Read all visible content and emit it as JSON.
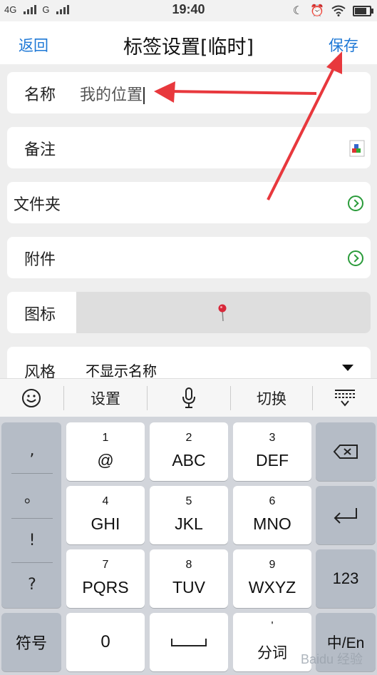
{
  "status_bar": {
    "signal1": "4G",
    "signal2": "G",
    "time": "19:40"
  },
  "header": {
    "back": "返回",
    "title": "标签设置[临时]",
    "save": "保存"
  },
  "form": {
    "name_label": "名称",
    "name_value": "我的位置",
    "note_label": "备注",
    "folder_label": "文件夹",
    "attach_label": "附件",
    "icon_label": "图标",
    "style_label": "风格",
    "style_value": "不显示名称"
  },
  "keyboard_toolbar": {
    "settings": "设置",
    "switch": "切换"
  },
  "keyboard": {
    "punct": [
      ",",
      "。",
      "!",
      "?"
    ],
    "keys": [
      {
        "num": "1",
        "letters": "@"
      },
      {
        "num": "2",
        "letters": "ABC"
      },
      {
        "num": "3",
        "letters": "DEF"
      },
      {
        "num": "4",
        "letters": "GHI"
      },
      {
        "num": "5",
        "letters": "JKL"
      },
      {
        "num": "6",
        "letters": "MNO"
      },
      {
        "num": "7",
        "letters": "PQRS"
      },
      {
        "num": "8",
        "letters": "TUV"
      },
      {
        "num": "9",
        "letters": "WXYZ"
      }
    ],
    "key_123": "123",
    "symbols": "符号",
    "zero": "0",
    "fenci_top": "'",
    "fenci": "分词",
    "lang": "中/En"
  },
  "watermark": "Baidu 经验",
  "colors": {
    "accent": "#1e78d6",
    "annotation": "#e8383d",
    "green": "#2a9b3a"
  }
}
